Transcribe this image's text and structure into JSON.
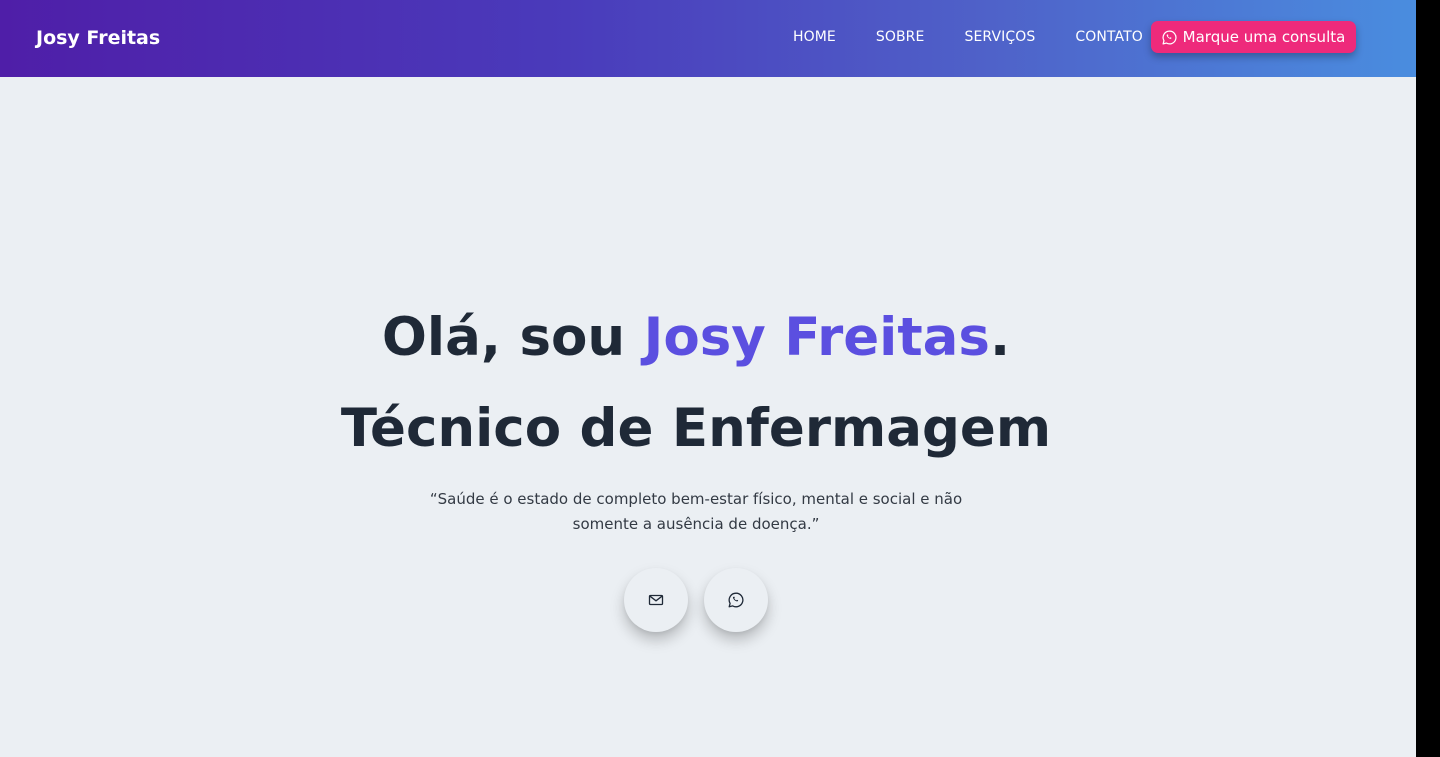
{
  "header": {
    "brand": "Josy Freitas",
    "nav": [
      {
        "label": "HOME"
      },
      {
        "label": "SOBRE"
      },
      {
        "label": "SERVIÇOS"
      },
      {
        "label": "CONTATO"
      }
    ],
    "cta_label": "Marque uma consulta",
    "cta_icon": "whatsapp-icon"
  },
  "hero": {
    "greeting_prefix": "Olá, sou ",
    "name": "Josy Freitas",
    "greeting_suffix": ".",
    "role": "Técnico de Enfermagem",
    "quote": "“Saúde é o estado de completo bem-estar físico, mental e social e não somente a ausência de doença.”"
  },
  "social": {
    "items": [
      {
        "icon": "mail-icon"
      },
      {
        "icon": "whatsapp-icon"
      }
    ]
  },
  "colors": {
    "accent": "#5b4fe0",
    "cta": "#ee2a7b",
    "heading": "#1f2937",
    "background": "#ebeff3",
    "gradient_start": "#4f1ea8",
    "gradient_end": "#4a8ddf"
  }
}
